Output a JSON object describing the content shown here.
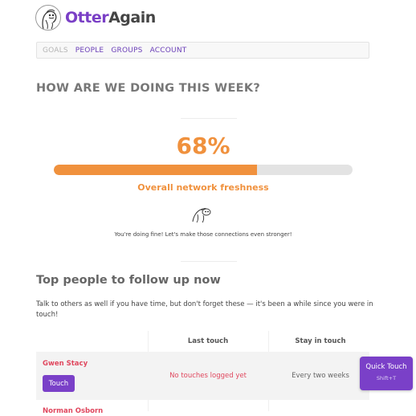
{
  "brand": {
    "name_part1": "Otter",
    "name_part2": "Again",
    "brand_color": "#7a3fc6"
  },
  "nav": {
    "items": [
      {
        "label": "GOALS",
        "active": true
      },
      {
        "label": "PEOPLE",
        "active": false
      },
      {
        "label": "GROUPS",
        "active": false
      },
      {
        "label": "ACCOUNT",
        "active": false
      }
    ]
  },
  "goals": {
    "heading": "HOW ARE WE DOING THIS WEEK?",
    "percent_text": "68%",
    "progress_fraction": 0.68,
    "label": "Overall network freshness",
    "message": "You're doing fine! Let's make those connections even stronger!",
    "accent_color": "#f0913d"
  },
  "followup": {
    "title": "Top people to follow up now",
    "description": "Talk to others as well if you have time, but don't forget these — it's been a while since you were in touch!",
    "columns": {
      "person": "",
      "last_touch": "Last touch",
      "stay_in_touch": "Stay in touch"
    },
    "rows": [
      {
        "name": "Gwen Stacy",
        "touch_button": "Touch",
        "last_touch": "No touches logged yet",
        "frequency": "Every two weeks"
      },
      {
        "name": "Norman Osborn"
      }
    ]
  },
  "quick_touch": {
    "label": "Quick Touch",
    "shortcut": "Shift+T"
  }
}
